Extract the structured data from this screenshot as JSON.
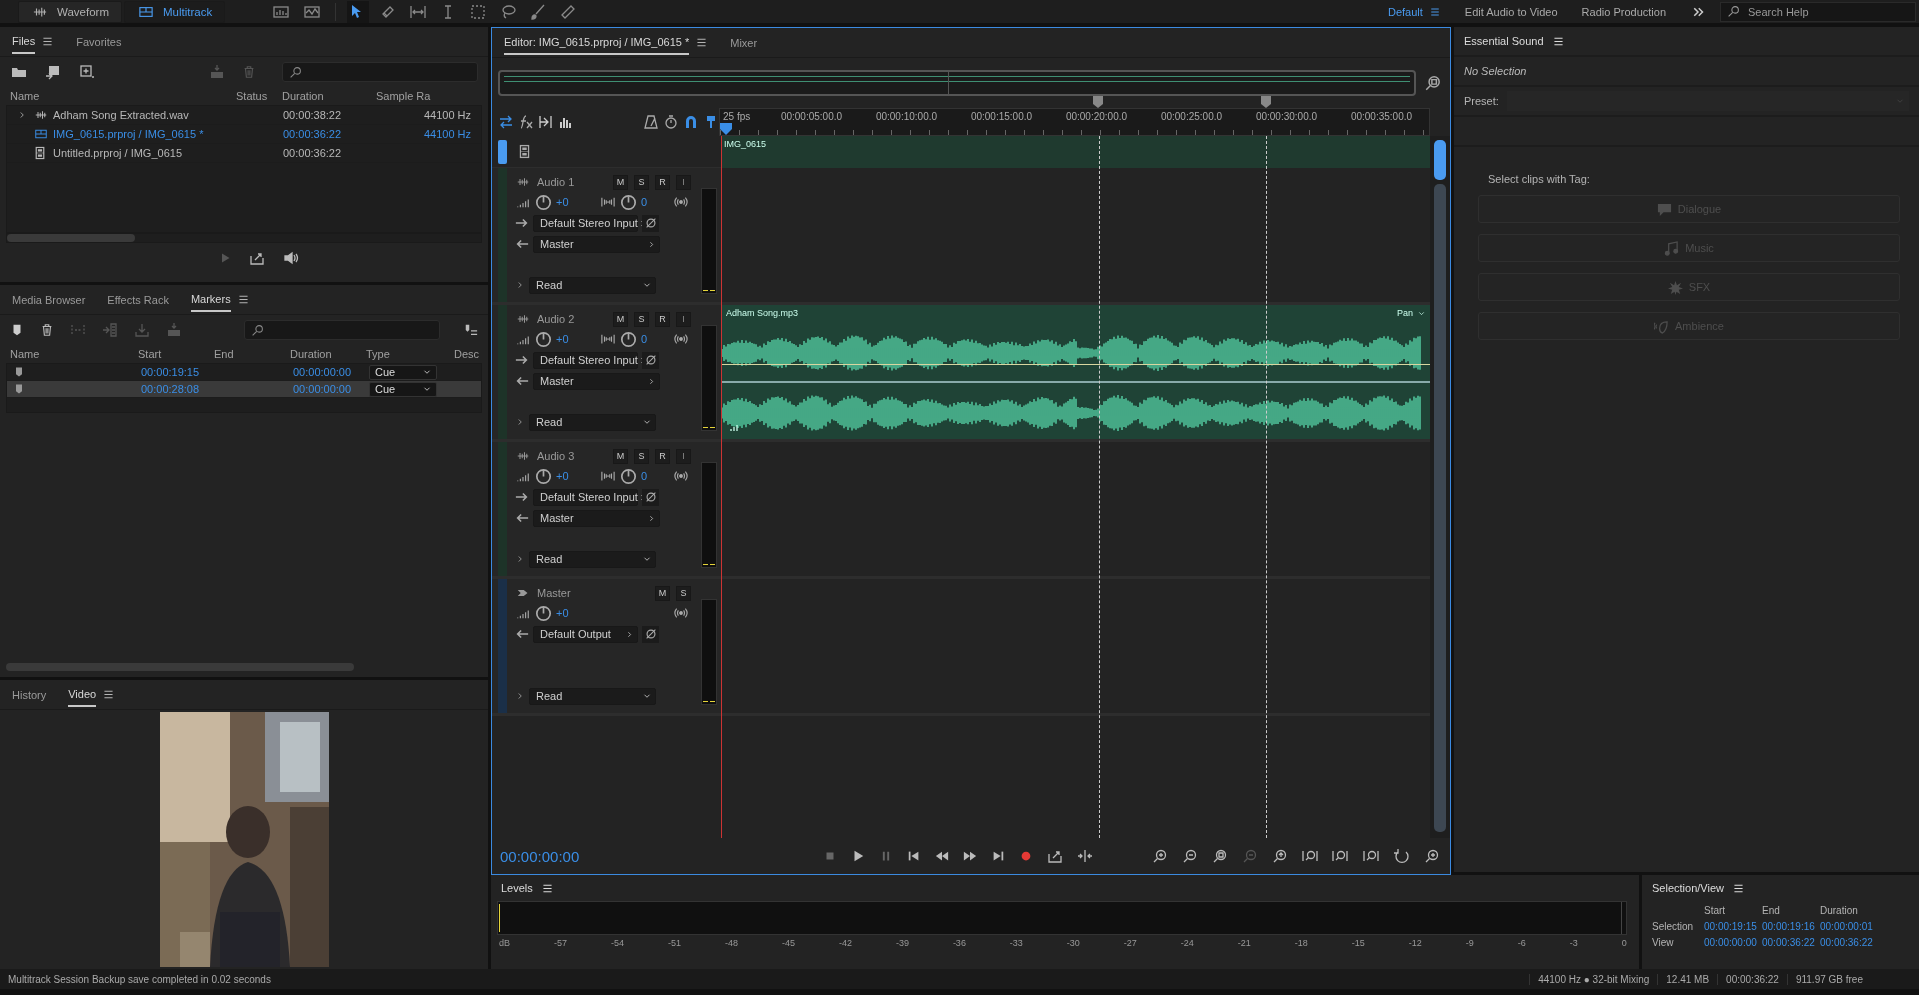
{
  "top_bar": {
    "modes": [
      {
        "label": "Waveform",
        "selected": false
      },
      {
        "label": "Multitrack",
        "selected": true
      }
    ],
    "workspaces": [
      {
        "label": "Default",
        "selected": true
      },
      {
        "label": "Edit Audio to Video",
        "selected": false
      },
      {
        "label": "Radio Production",
        "selected": false
      }
    ],
    "search": {
      "placeholder": "Search Help"
    }
  },
  "files_panel": {
    "tabs": [
      {
        "label": "Files",
        "selected": true
      },
      {
        "label": "Favorites",
        "selected": false
      }
    ],
    "columns": [
      "Name",
      "Status",
      "Duration",
      "Sample Ra"
    ],
    "rows": [
      {
        "kind": "audio",
        "name": "Adham Song Extracted.wav",
        "duration": "00:00:38:22",
        "sample_rate": "44100 Hz",
        "selected": false,
        "expandable": true
      },
      {
        "kind": "session",
        "name": "IMG_0615.prproj / IMG_0615 *",
        "duration": "00:00:36:22",
        "sample_rate": "44100 Hz",
        "selected": true,
        "expandable": false
      },
      {
        "kind": "video",
        "name": "Untitled.prproj / IMG_0615",
        "duration": "00:00:36:22",
        "selected": false,
        "expandable": false
      }
    ]
  },
  "markers_panel": {
    "tabs": [
      {
        "label": "Media Browser",
        "selected": false
      },
      {
        "label": "Effects Rack",
        "selected": false
      },
      {
        "label": "Markers",
        "selected": true
      }
    ],
    "columns": [
      "Name",
      "Start",
      "End",
      "Duration",
      "Type",
      "Desc"
    ],
    "rows": [
      {
        "start": "00:00:19:15",
        "duration": "00:00:00:00",
        "type": "Cue",
        "selected": false
      },
      {
        "start": "00:00:28:08",
        "duration": "00:00:00:00",
        "type": "Cue",
        "selected": true
      }
    ]
  },
  "video_panel": {
    "tabs": [
      {
        "label": "History",
        "selected": false
      },
      {
        "label": "Video",
        "selected": true
      }
    ],
    "kind": "picture"
  },
  "editor": {
    "tabs": [
      {
        "label": "Editor: IMG_0615.prproj / IMG_0615 *",
        "selected": true
      },
      {
        "label": "Mixer",
        "selected": false
      }
    ],
    "ruler": [
      "25 fps",
      "00:00:05:00.0",
      "00:00:10:00.0",
      "00:00:15:00.0",
      "00:00:20:00.0",
      "00:00:25:00.0",
      "00:00:30:00.0",
      "00:00:35:00.0"
    ],
    "video_track": {
      "clip": "IMG_0615"
    },
    "tracks": [
      {
        "kind": "audio",
        "name": "Audio 1",
        "buttons": [
          {
            "label": "M",
            "disabled": false
          },
          {
            "label": "S",
            "disabled": false
          },
          {
            "label": "R",
            "disabled": false
          },
          {
            "label": "I",
            "disabled": true
          }
        ],
        "volume": "+0",
        "pan": "0",
        "input": "Default Stereo Input",
        "output": "Master",
        "automation": "Read"
      },
      {
        "kind": "audio",
        "name": "Audio 2",
        "buttons": [
          {
            "label": "M",
            "disabled": false
          },
          {
            "label": "S",
            "disabled": false
          },
          {
            "label": "R",
            "disabled": false
          },
          {
            "label": "I",
            "disabled": true
          }
        ],
        "volume": "+0",
        "pan": "0",
        "input": "Default Stereo Input",
        "output": "Master",
        "automation": "Read",
        "clip": {
          "name": "Adham Song.mp3",
          "envelope": "Pan"
        }
      },
      {
        "kind": "audio",
        "name": "Audio 3",
        "buttons": [
          {
            "label": "M",
            "disabled": false
          },
          {
            "label": "S",
            "disabled": false
          },
          {
            "label": "R",
            "disabled": false
          },
          {
            "label": "I",
            "disabled": true
          }
        ],
        "volume": "+0",
        "pan": "0",
        "input": "Default Stereo Input",
        "output": "Master",
        "automation": "Read"
      },
      {
        "kind": "master",
        "name": "Master",
        "buttons": [
          {
            "label": "M",
            "disabled": false
          },
          {
            "label": "S",
            "disabled": false
          }
        ],
        "volume": "+0",
        "output": "Default Output",
        "automation": "Read"
      }
    ],
    "timecode": "00:00:00:00"
  },
  "essential_sound": {
    "title": "Essential Sound",
    "status": "No Selection",
    "preset_label": "Preset:",
    "tag_heading": "Select clips with Tag:",
    "tags": [
      {
        "kind": "dialogue",
        "label": "Dialogue",
        "disabled": true
      },
      {
        "kind": "music",
        "label": "Music",
        "disabled": true
      },
      {
        "kind": "sfx",
        "label": "SFX",
        "disabled": true
      },
      {
        "kind": "ambience",
        "label": "Ambience",
        "disabled": true
      }
    ]
  },
  "levels": {
    "title": "Levels",
    "scale": [
      "dB",
      "-57",
      "-54",
      "-51",
      "-48",
      "-45",
      "-42",
      "-39",
      "-36",
      "-33",
      "-30",
      "-27",
      "-24",
      "-21",
      "-18",
      "-15",
      "-12",
      "-9",
      "-6",
      "-3",
      "0"
    ]
  },
  "selection_view": {
    "title": "Selection/View",
    "columns": [
      "Start",
      "End",
      "Duration"
    ],
    "rows": [
      {
        "label": "Selection",
        "values": [
          "00:00:19:15",
          "00:00:19:16",
          "00:00:00:01"
        ]
      },
      {
        "label": "View",
        "values": [
          "00:00:00:00",
          "00:00:36:22",
          "00:00:36:22"
        ]
      }
    ]
  },
  "status_bar": {
    "message": "Multitrack Session Backup save completed in 0.02 seconds",
    "items": [
      "44100 Hz ● 32-bit Mixing",
      "12.41 MB",
      "00:00:36:22",
      "911.97 GB free"
    ]
  }
}
